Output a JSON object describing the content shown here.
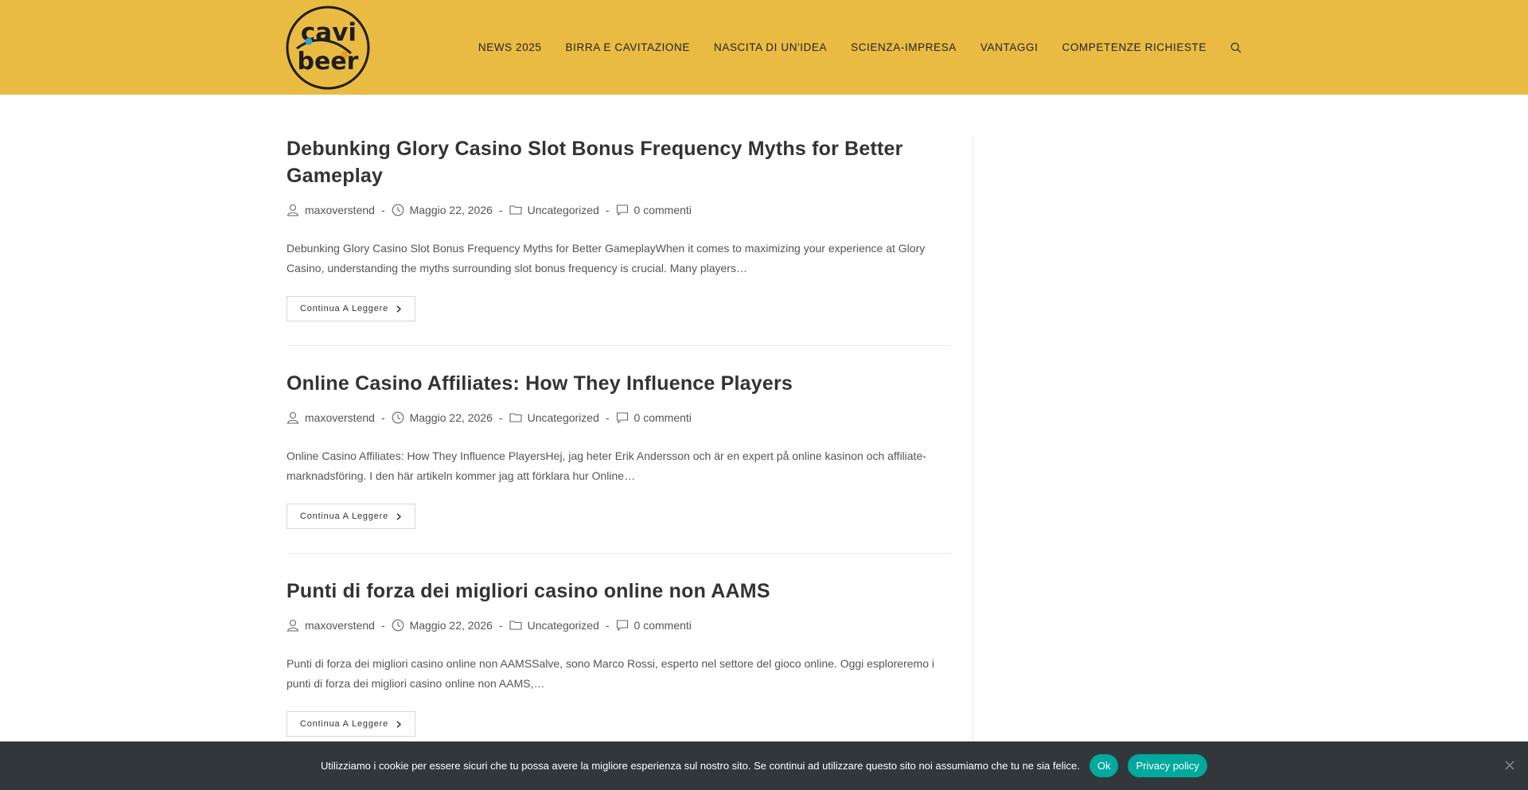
{
  "header": {
    "logo_top": "cavi",
    "logo_bottom": "beer",
    "nav": [
      "NEWS 2025",
      "BIRRA E CAVITAZIONE",
      "NASCITA DI UN'IDEA",
      "SCIENZA-IMPRESA",
      "VANTAGGI",
      "COMPETENZE RICHIESTE"
    ],
    "search_icon": "search-icon",
    "bg_color": "#e9bb43"
  },
  "posts": [
    {
      "title": "Debunking Glory Casino Slot Bonus Frequency Myths for Better Gameplay",
      "author": "maxoverstend",
      "date": "Maggio 22, 2026",
      "category": "Uncategorized",
      "comments": "0 commenti",
      "excerpt": "Debunking Glory Casino Slot Bonus Frequency Myths for Better GameplayWhen it comes to maximizing your experience at Glory Casino, understanding the myths surrounding slot bonus frequency is crucial. Many players…",
      "read_more": "Continua A Leggere"
    },
    {
      "title": "Online Casino Affiliates: How They Influence Players",
      "author": "maxoverstend",
      "date": "Maggio 22, 2026",
      "category": "Uncategorized",
      "comments": "0 commenti",
      "excerpt": "Online Casino Affiliates: How They Influence PlayersHej, jag heter Erik Andersson och är en expert på online kasinon och affiliate-marknadsföring. I den här artikeln kommer jag att förklara hur Online…",
      "read_more": "Continua A Leggere"
    },
    {
      "title": "Punti di forza dei migliori casino online non AAMS",
      "author": "maxoverstend",
      "date": "Maggio 22, 2026",
      "category": "Uncategorized",
      "comments": "0 commenti",
      "excerpt": "Punti di forza dei migliori casino online non AAMSSalve, sono Marco Rossi, esperto nel settore del gioco online. Oggi esploreremo i punti di forza dei migliori casino online non AAMS,…",
      "read_more": "Continua A Leggere"
    }
  ],
  "meta_separator": "-",
  "cookie": {
    "text": "Utilizziamo i cookie per essere sicuri che tu possa avere la migliore esperienza sul nostro sito. Se continui ad utilizzare questo sito noi assumiamo che tu ne sia felice.",
    "ok": "Ok",
    "privacy": "Privacy policy",
    "bg_color": "#32373c",
    "button_color": "#00a99d"
  }
}
